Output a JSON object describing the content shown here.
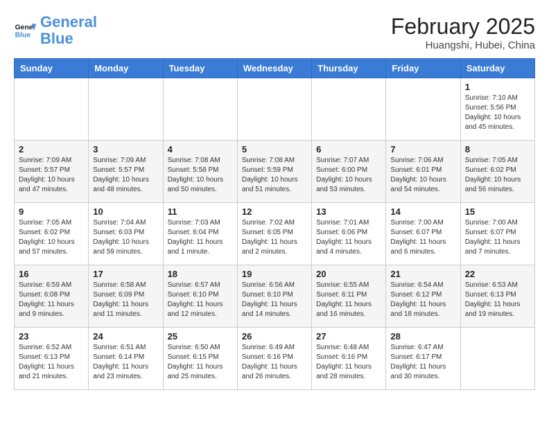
{
  "header": {
    "logo_general": "General",
    "logo_blue": "Blue",
    "month": "February 2025",
    "location": "Huangshi, Hubei, China"
  },
  "weekdays": [
    "Sunday",
    "Monday",
    "Tuesday",
    "Wednesday",
    "Thursday",
    "Friday",
    "Saturday"
  ],
  "weeks": [
    [
      {
        "day": "",
        "info": ""
      },
      {
        "day": "",
        "info": ""
      },
      {
        "day": "",
        "info": ""
      },
      {
        "day": "",
        "info": ""
      },
      {
        "day": "",
        "info": ""
      },
      {
        "day": "",
        "info": ""
      },
      {
        "day": "1",
        "info": "Sunrise: 7:10 AM\nSunset: 5:56 PM\nDaylight: 10 hours and 45 minutes."
      }
    ],
    [
      {
        "day": "2",
        "info": "Sunrise: 7:09 AM\nSunset: 5:57 PM\nDaylight: 10 hours and 47 minutes."
      },
      {
        "day": "3",
        "info": "Sunrise: 7:09 AM\nSunset: 5:57 PM\nDaylight: 10 hours and 48 minutes."
      },
      {
        "day": "4",
        "info": "Sunrise: 7:08 AM\nSunset: 5:58 PM\nDaylight: 10 hours and 50 minutes."
      },
      {
        "day": "5",
        "info": "Sunrise: 7:08 AM\nSunset: 5:59 PM\nDaylight: 10 hours and 51 minutes."
      },
      {
        "day": "6",
        "info": "Sunrise: 7:07 AM\nSunset: 6:00 PM\nDaylight: 10 hours and 53 minutes."
      },
      {
        "day": "7",
        "info": "Sunrise: 7:06 AM\nSunset: 6:01 PM\nDaylight: 10 hours and 54 minutes."
      },
      {
        "day": "8",
        "info": "Sunrise: 7:05 AM\nSunset: 6:02 PM\nDaylight: 10 hours and 56 minutes."
      }
    ],
    [
      {
        "day": "9",
        "info": "Sunrise: 7:05 AM\nSunset: 6:02 PM\nDaylight: 10 hours and 57 minutes."
      },
      {
        "day": "10",
        "info": "Sunrise: 7:04 AM\nSunset: 6:03 PM\nDaylight: 10 hours and 59 minutes."
      },
      {
        "day": "11",
        "info": "Sunrise: 7:03 AM\nSunset: 6:04 PM\nDaylight: 11 hours and 1 minute."
      },
      {
        "day": "12",
        "info": "Sunrise: 7:02 AM\nSunset: 6:05 PM\nDaylight: 11 hours and 2 minutes."
      },
      {
        "day": "13",
        "info": "Sunrise: 7:01 AM\nSunset: 6:06 PM\nDaylight: 11 hours and 4 minutes."
      },
      {
        "day": "14",
        "info": "Sunrise: 7:00 AM\nSunset: 6:07 PM\nDaylight: 11 hours and 6 minutes."
      },
      {
        "day": "15",
        "info": "Sunrise: 7:00 AM\nSunset: 6:07 PM\nDaylight: 11 hours and 7 minutes."
      }
    ],
    [
      {
        "day": "16",
        "info": "Sunrise: 6:59 AM\nSunset: 6:08 PM\nDaylight: 11 hours and 9 minutes."
      },
      {
        "day": "17",
        "info": "Sunrise: 6:58 AM\nSunset: 6:09 PM\nDaylight: 11 hours and 11 minutes."
      },
      {
        "day": "18",
        "info": "Sunrise: 6:57 AM\nSunset: 6:10 PM\nDaylight: 11 hours and 12 minutes."
      },
      {
        "day": "19",
        "info": "Sunrise: 6:56 AM\nSunset: 6:10 PM\nDaylight: 11 hours and 14 minutes."
      },
      {
        "day": "20",
        "info": "Sunrise: 6:55 AM\nSunset: 6:11 PM\nDaylight: 11 hours and 16 minutes."
      },
      {
        "day": "21",
        "info": "Sunrise: 6:54 AM\nSunset: 6:12 PM\nDaylight: 11 hours and 18 minutes."
      },
      {
        "day": "22",
        "info": "Sunrise: 6:53 AM\nSunset: 6:13 PM\nDaylight: 11 hours and 19 minutes."
      }
    ],
    [
      {
        "day": "23",
        "info": "Sunrise: 6:52 AM\nSunset: 6:13 PM\nDaylight: 11 hours and 21 minutes."
      },
      {
        "day": "24",
        "info": "Sunrise: 6:51 AM\nSunset: 6:14 PM\nDaylight: 11 hours and 23 minutes."
      },
      {
        "day": "25",
        "info": "Sunrise: 6:50 AM\nSunset: 6:15 PM\nDaylight: 11 hours and 25 minutes."
      },
      {
        "day": "26",
        "info": "Sunrise: 6:49 AM\nSunset: 6:16 PM\nDaylight: 11 hours and 26 minutes."
      },
      {
        "day": "27",
        "info": "Sunrise: 6:48 AM\nSunset: 6:16 PM\nDaylight: 11 hours and 28 minutes."
      },
      {
        "day": "28",
        "info": "Sunrise: 6:47 AM\nSunset: 6:17 PM\nDaylight: 11 hours and 30 minutes."
      },
      {
        "day": "",
        "info": ""
      }
    ]
  ]
}
